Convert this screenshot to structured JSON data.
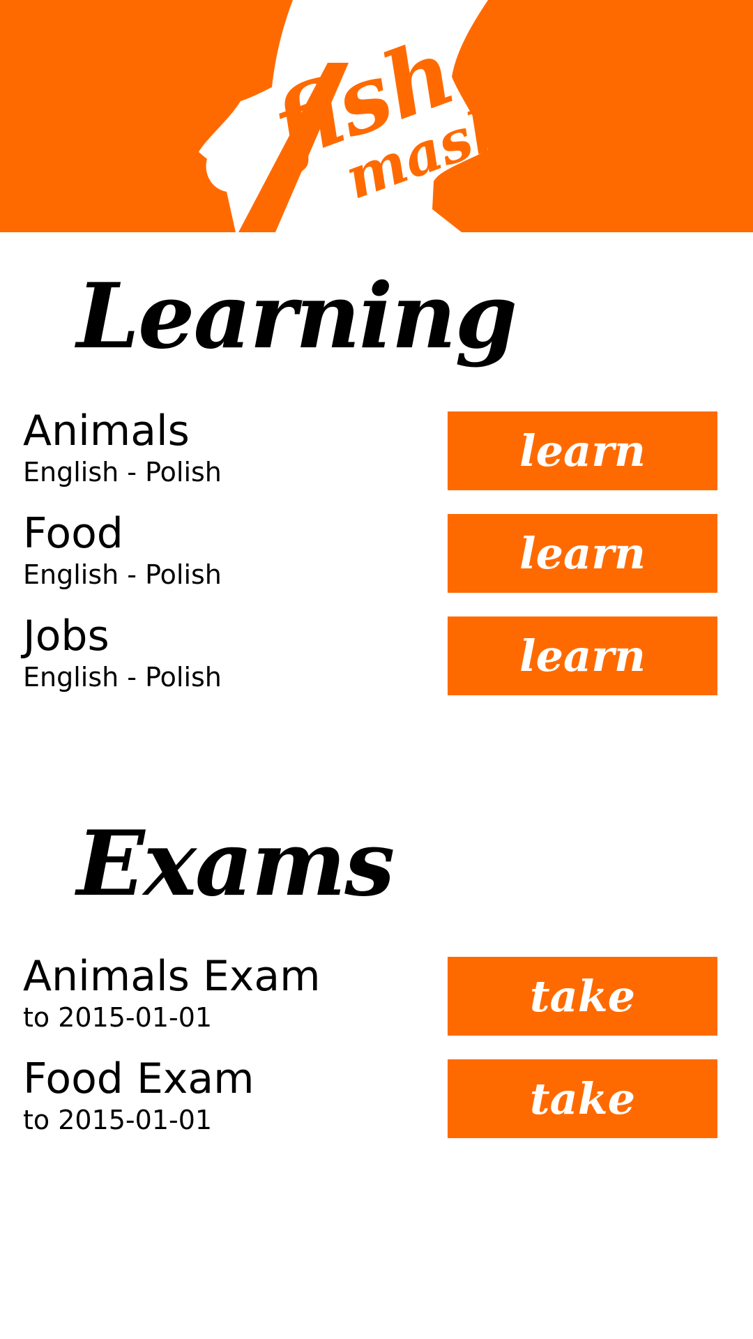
{
  "app": {
    "logo_text": "fish mash",
    "logo_line1": "fish",
    "logo_line2": "mash",
    "accent_color": "#ff6a00"
  },
  "learning": {
    "title": "Learning",
    "items": [
      {
        "name": "Animals",
        "languages": "English - Polish",
        "action_label": "learn"
      },
      {
        "name": "Food",
        "languages": "English - Polish",
        "action_label": "learn"
      },
      {
        "name": "Jobs",
        "languages": "English - Polish",
        "action_label": "learn"
      }
    ]
  },
  "exams": {
    "title": "Exams",
    "items": [
      {
        "name": "Animals Exam",
        "due": "to 2015-01-01",
        "action_label": "take"
      },
      {
        "name": "Food Exam",
        "due": "to 2015-01-01",
        "action_label": "take"
      }
    ]
  }
}
